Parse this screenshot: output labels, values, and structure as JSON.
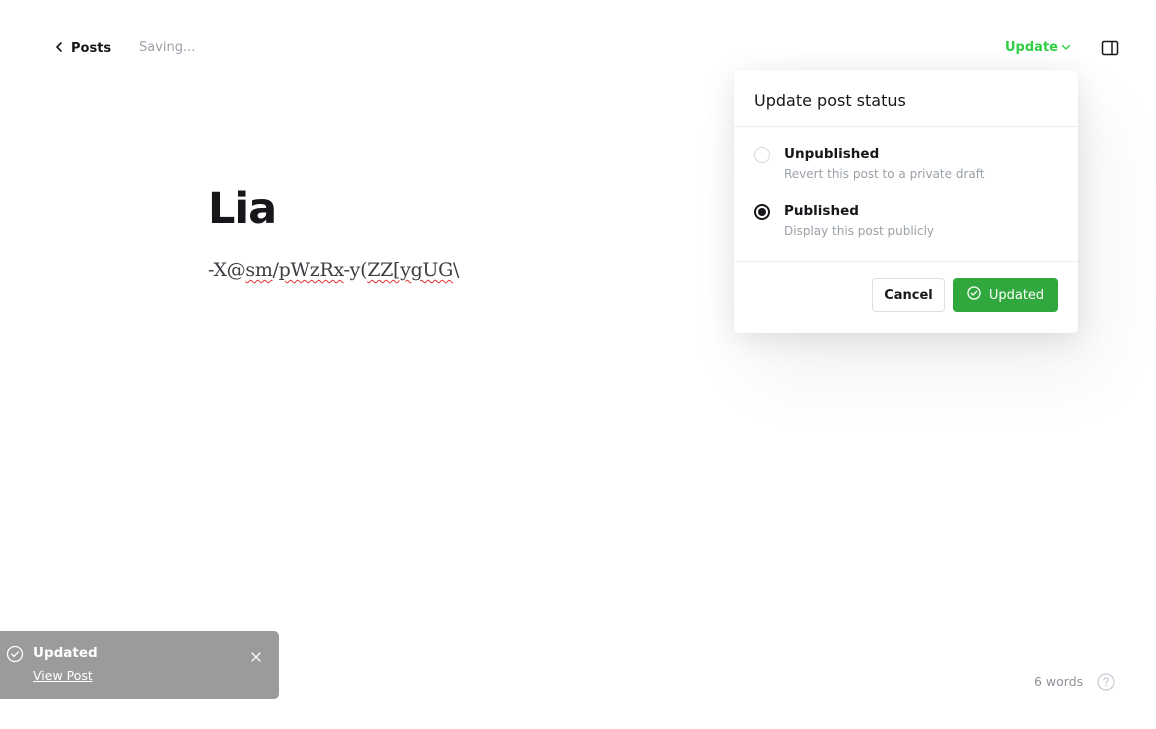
{
  "header": {
    "back_label": "Posts",
    "status_text": "Saving...",
    "update_label": "Update",
    "icons": {
      "back": "chevron-left-icon",
      "update_dropdown": "chevron-down-icon",
      "sidebar": "sidebar-toggle-icon"
    },
    "accent_color": "#30cf43"
  },
  "editor": {
    "title": "Lia",
    "body_segments": [
      "-X@",
      "sm",
      "/",
      "pWzRx",
      "-y(",
      "ZZ[ygUG",
      "\\"
    ]
  },
  "popover": {
    "title": "Update post status",
    "options": [
      {
        "label": "Unpublished",
        "description": "Revert this post to a private draft",
        "selected": false
      },
      {
        "label": "Published",
        "description": "Display this post publicly",
        "selected": true
      }
    ],
    "cancel_label": "Cancel",
    "confirm_label": "Updated",
    "confirm_color": "#30a83d"
  },
  "toast": {
    "title": "Updated",
    "link_label": "View Post",
    "background": "#9b9b9b"
  },
  "footer": {
    "word_count": "6 words"
  }
}
